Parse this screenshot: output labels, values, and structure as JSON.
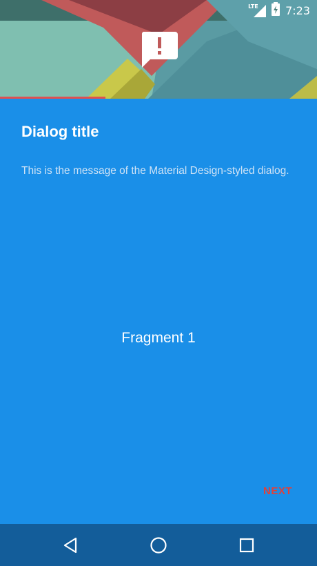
{
  "status_bar": {
    "network_label": "LTE",
    "time": "7:23"
  },
  "header": {
    "icon": "alert-message-icon",
    "accent_color": "#e05050"
  },
  "dialog": {
    "title": "Dialog title",
    "message": "This is the message of the Material Design-styled dialog.",
    "fragment_label": "Fragment 1",
    "next_label": "NEXT",
    "background_color": "#1a8fe8",
    "next_color": "#e0403a"
  },
  "nav_bar": {
    "back_icon": "back-triangle-icon",
    "home_icon": "home-circle-icon",
    "recents_icon": "recents-square-icon",
    "background_color": "#135d9a"
  }
}
